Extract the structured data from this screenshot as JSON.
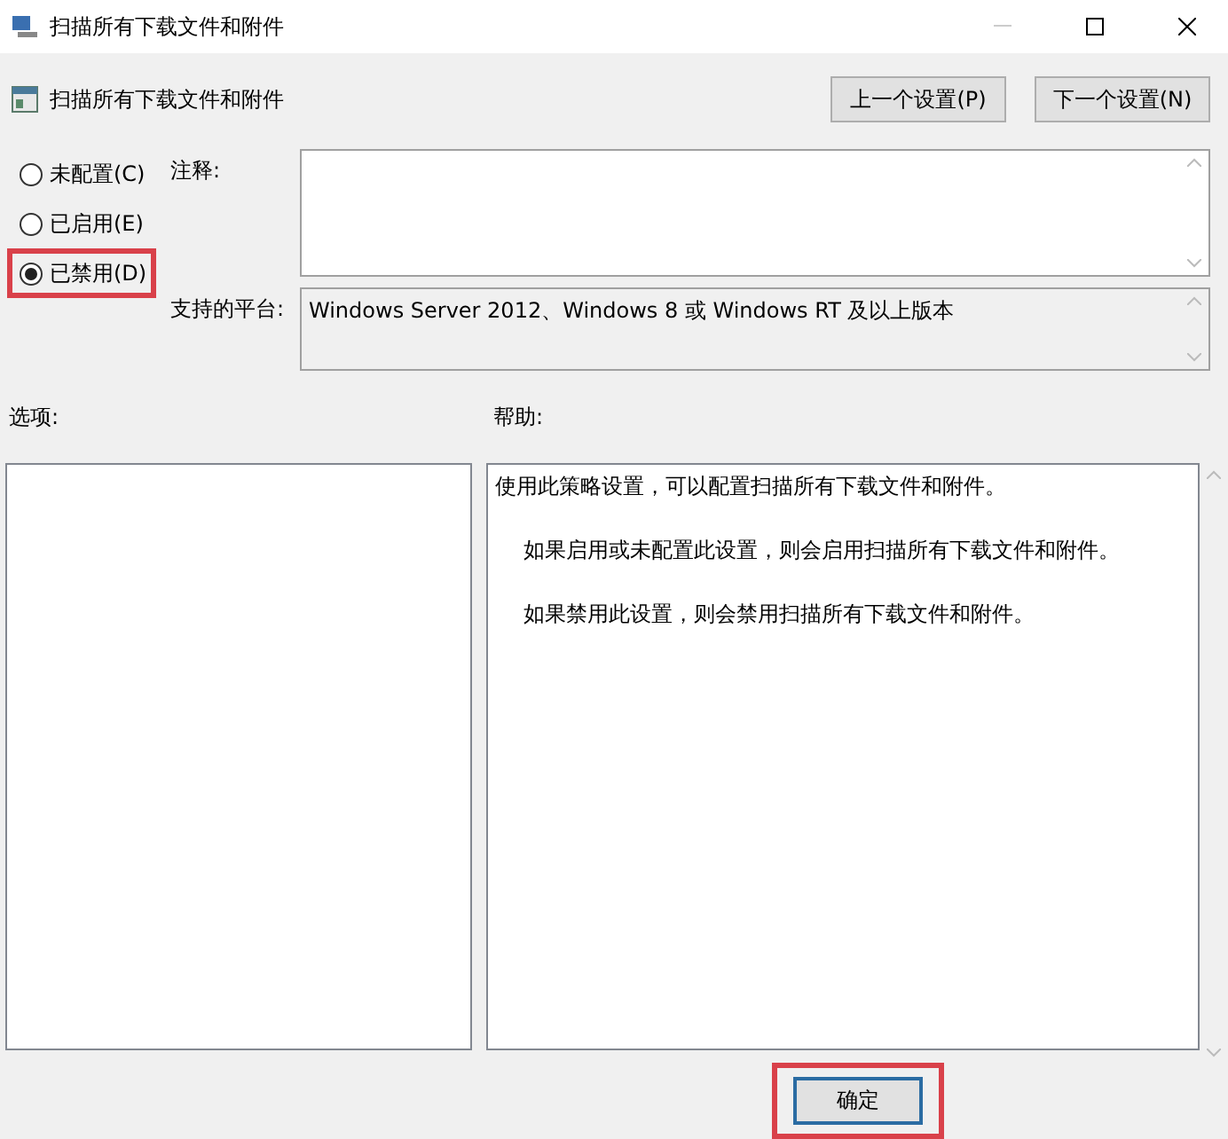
{
  "window": {
    "title": "扫描所有下载文件和附件"
  },
  "header": {
    "title": "扫描所有下载文件和附件",
    "buttons": [
      {
        "label": "上一个设置(P)"
      },
      {
        "label": "下一个设置(N)"
      }
    ]
  },
  "states": [
    {
      "label": "未配置(C)",
      "selected": false,
      "highlighted": false
    },
    {
      "label": "已启用(E)",
      "selected": false,
      "highlighted": false
    },
    {
      "label": "已禁用(D)",
      "selected": true,
      "highlighted": true
    }
  ],
  "comment": {
    "label": "注释:"
  },
  "platform": {
    "label": "支持的平台:",
    "value": "Windows Server 2012、Windows 8 或 Windows RT 及以上版本"
  },
  "options": {
    "label": "选项:"
  },
  "help": {
    "label": "帮助:",
    "paragraphs": [
      "使用此策略设置，可以配置扫描所有下载文件和附件。",
      "如果启用或未配置此设置，则会启用扫描所有下载文件和附件。",
      "如果禁用此设置，则会禁用扫描所有下载文件和附件。"
    ]
  },
  "ok_button": {
    "label": "确定",
    "highlighted": true
  }
}
